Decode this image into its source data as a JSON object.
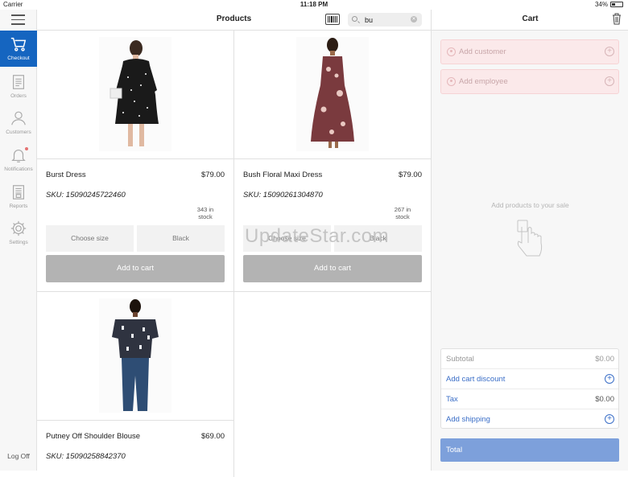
{
  "status_bar": {
    "carrier": "Carrier",
    "time": "11:18 PM",
    "battery": "34%"
  },
  "sidebar": {
    "items": [
      {
        "label": "Checkout",
        "icon": "cart-icon",
        "active": true
      },
      {
        "label": "Orders",
        "icon": "document-icon",
        "active": false
      },
      {
        "label": "Customers",
        "icon": "person-icon",
        "active": false
      },
      {
        "label": "Notifications",
        "icon": "bell-icon",
        "active": false
      },
      {
        "label": "Reports",
        "icon": "report-icon",
        "active": false
      },
      {
        "label": "Settings",
        "icon": "gear-icon",
        "active": false
      }
    ],
    "logoff": "Log Off"
  },
  "products": {
    "title": "Products",
    "search": {
      "value": "bu"
    },
    "items": [
      {
        "name": "Burst Dress",
        "price": "$79.00",
        "sku": "SKU: 15090245722460",
        "stock": "343 in stock",
        "size_label": "Choose size",
        "color_label": "Black",
        "add_label": "Add to cart"
      },
      {
        "name": "Bush Floral Maxi Dress",
        "price": "$79.00",
        "sku": "SKU: 15090261304870",
        "stock": "267 in stock",
        "size_label": "Choose size",
        "color_label": "Black",
        "add_label": "Add to cart"
      },
      {
        "name": "Putney Off Shoulder Blouse",
        "price": "$69.00",
        "sku": "SKU: 15090258842370",
        "stock": ""
      }
    ]
  },
  "watermark": "UpdateStar.com",
  "cart": {
    "title": "Cart",
    "add_customer": "Add customer",
    "add_employee": "Add employee",
    "empty_message": "Add products to your sale",
    "subtotal_label": "Subtotal",
    "subtotal_value": "$0.00",
    "discount_label": "Add cart discount",
    "tax_label": "Tax",
    "tax_value": "$0.00",
    "shipping_label": "Add shipping",
    "total_label": "Total"
  },
  "colors": {
    "accent": "#1565c0",
    "total_bar": "#7da0db",
    "link": "#3a6ec7"
  }
}
